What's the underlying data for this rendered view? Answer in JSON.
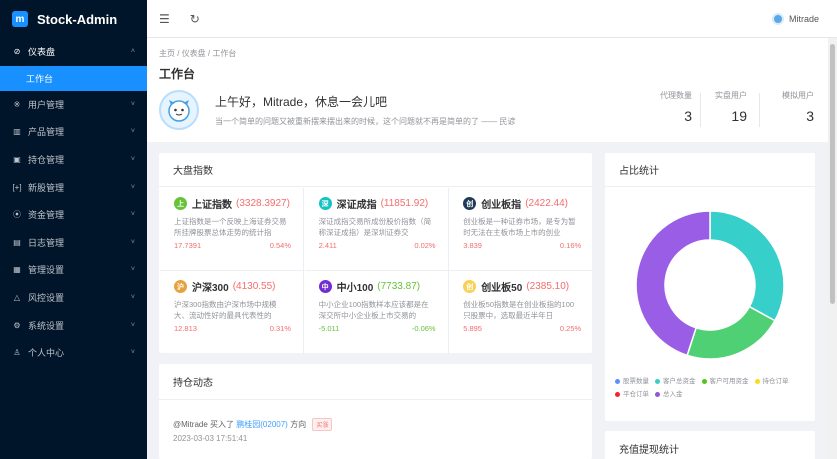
{
  "app": {
    "title": "Stock-Admin",
    "logo_glyph": "m"
  },
  "sidebar": {
    "items": [
      {
        "icon": "⊘",
        "label": "仪表盘",
        "arrow": "˄",
        "open": true
      },
      {
        "icon": "※",
        "label": "用户管理",
        "arrow": "˅"
      },
      {
        "icon": "▥",
        "label": "产品管理",
        "arrow": "˅"
      },
      {
        "icon": "▣",
        "label": "持仓管理",
        "arrow": "˅"
      },
      {
        "icon": "[+]",
        "label": "新股管理",
        "arrow": "˅"
      },
      {
        "icon": "⦿",
        "label": "资金管理",
        "arrow": "˅"
      },
      {
        "icon": "▤",
        "label": "日志管理",
        "arrow": "˅"
      },
      {
        "icon": "▦",
        "label": "管理设置",
        "arrow": "˅"
      },
      {
        "icon": "△",
        "label": "风控设置",
        "arrow": "˅"
      },
      {
        "icon": "⚙",
        "label": "系统设置",
        "arrow": "˅"
      },
      {
        "icon": "♙",
        "label": "个人中心",
        "arrow": "˅"
      }
    ],
    "submenu_active": "工作台"
  },
  "header": {
    "menu_icon": "☰",
    "refresh_icon": "↻",
    "user_name": "Mitrade"
  },
  "breadcrumb": "主页 / 仪表盘 / 工作台",
  "page_title": "工作台",
  "welcome": {
    "greeting": "上午好，Mitrade，休息一会儿吧",
    "quote": "当一个简单的问题又被重新摆来摆出来的时候，这个问题就不再是简单的了 —— 民谚"
  },
  "stats": [
    {
      "label": "代理数量",
      "value": "3"
    },
    {
      "label": "实盘用户",
      "value": "19"
    },
    {
      "label": "模拟用户",
      "value": "3"
    }
  ],
  "index_card": {
    "title": "大盘指数",
    "items": [
      {
        "badge": "上",
        "color": "#67c23a",
        "name": "上证指数",
        "value": "(3328.3927)",
        "vcolor": "#f56c6c",
        "desc": "上证指数是一个反映上海证券交易所挂牌股票总体走势的统计指",
        "left": "17.7391",
        "right": "0.54%",
        "fcolor": "#f56c6c"
      },
      {
        "badge": "深",
        "color": "#13c2c2",
        "name": "深证成指",
        "value": "(11851.92)",
        "vcolor": "#f56c6c",
        "desc": "深证成指交易所成份股价指数（简称深证成指）是深圳证券交",
        "left": "2.411",
        "right": "0.02%",
        "fcolor": "#f56c6c"
      },
      {
        "badge": "创",
        "color": "#1f3b57",
        "name": "创业板指",
        "value": "(2422.44)",
        "vcolor": "#f56c6c",
        "desc": "创业板是一种证券市场，是专为暂时无法在主板市场上市的创业",
        "left": "3.839",
        "right": "0.16%",
        "fcolor": "#f56c6c"
      },
      {
        "badge": "沪",
        "color": "#e6a23c",
        "name": "沪深300",
        "value": "(4130.55)",
        "vcolor": "#f56c6c",
        "desc": "沪深300指数由沪深市场中规模大、流动性好的最具代表性的",
        "left": "12.813",
        "right": "0.31%",
        "fcolor": "#f56c6c"
      },
      {
        "badge": "中",
        "color": "#722ed1",
        "name": "中小100",
        "value": "(7733.87)",
        "vcolor": "#67c23a",
        "desc": "中小企业100指数样本应该都是在深交所中小企业板上市交易的",
        "left": "-5.011",
        "right": "-0.06%",
        "fcolor": "#67c23a"
      },
      {
        "badge": "创",
        "color": "#f7d154",
        "name": "创业板50",
        "value": "(2385.10)",
        "vcolor": "#f56c6c",
        "desc": "创业板50指数是在创业板指的100只股票中，选取最近半年日",
        "left": "5.895",
        "right": "0.25%",
        "fcolor": "#f56c6c"
      }
    ]
  },
  "dynamics": {
    "title": "持仓动态",
    "entry": {
      "user": "@Mitrade",
      "action": "买入了",
      "stock": "鹏桂园(02007)",
      "direction_label": "方向",
      "tag": "买涨",
      "time": "2023-03-03 17:51:41"
    }
  },
  "ratio_card": {
    "title": "占比统计",
    "legend": [
      {
        "label": "股票数量",
        "color": "#5b8ff9"
      },
      {
        "label": "客户总资金",
        "color": "#36cfc9"
      },
      {
        "label": "客户可用资金",
        "color": "#52c41a"
      },
      {
        "label": "持仓订单",
        "color": "#fadb14"
      },
      {
        "label": "平仓订单",
        "color": "#f5222d"
      },
      {
        "label": "总入金",
        "color": "#9254de"
      }
    ]
  },
  "chart_data": {
    "type": "pie",
    "categories": [
      "股票数量",
      "客户总资金",
      "客户可用资金",
      "持仓订单",
      "平仓订单",
      "总入金"
    ],
    "values": [
      0,
      33,
      22,
      0,
      0,
      45
    ],
    "colors": [
      "#5b8ff9",
      "#36cfc9",
      "#4fd074",
      "#fadb14",
      "#f5222d",
      "#9a5ee6"
    ]
  },
  "recharge_card": {
    "title": "充值提现统计"
  }
}
